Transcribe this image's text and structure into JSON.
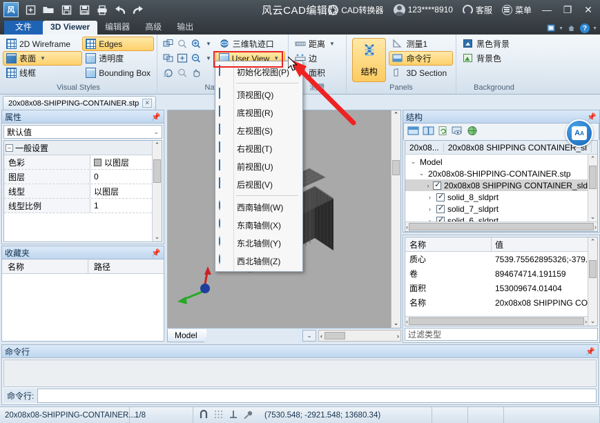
{
  "titlebar": {
    "app_title": "风云CAD编辑器",
    "quick_icons": [
      "new-file-icon",
      "open-folder-icon",
      "save-icon",
      "save-as-icon",
      "print-icon",
      "undo-icon",
      "redo-icon"
    ],
    "converter_label": "CAD转换器",
    "account_label": "123****8910",
    "support_label": "客服",
    "menu_label": "菜单",
    "minimize": "—",
    "maximize": "❐",
    "close": "✕"
  },
  "tabs": {
    "file_label": "文件",
    "items": [
      "3D Viewer",
      "编辑器",
      "高级",
      "输出"
    ],
    "active": "3D Viewer",
    "help_label": "?"
  },
  "ribbon": {
    "groups": [
      {
        "title": "Visual Styles",
        "col1": [
          "2D Wireframe",
          "表面",
          "线框"
        ],
        "col2": [
          "Edges",
          "透明度",
          "Bounding Box"
        ],
        "highlight": [
          "表面",
          "Edges"
        ]
      },
      {
        "title": "Navigation",
        "items": [
          "三维轨迹口",
          "User View"
        ],
        "highlight": [
          "User View"
        ]
      },
      {
        "title": "测量",
        "items": [
          "距离",
          "边",
          "面积"
        ]
      },
      {
        "title": "Panels",
        "big_label": "结构",
        "items": [
          "测量1",
          "命令行",
          "3D Section"
        ],
        "highlight": [
          "命令行"
        ]
      },
      {
        "title": "Background",
        "items": [
          "黑色背景",
          "背景色"
        ]
      }
    ]
  },
  "viewmenu": {
    "items": [
      {
        "label": "初始化视图(P)",
        "icon": "cube-icon"
      },
      {
        "label": "顶视图(Q)",
        "icon": "cube-top-icon"
      },
      {
        "label": "底视图(R)",
        "icon": "cube-bottom-icon"
      },
      {
        "label": "左视图(S)",
        "icon": "cube-left-icon"
      },
      {
        "label": "右视图(T)",
        "icon": "cube-right-icon"
      },
      {
        "label": "前视图(U)",
        "icon": "cube-front-icon"
      },
      {
        "label": "后视图(V)",
        "icon": "cube-back-icon"
      },
      {
        "label": "西南轴侧(W)",
        "icon": "iso-sw-icon"
      },
      {
        "label": "东南轴侧(X)",
        "icon": "iso-se-icon"
      },
      {
        "label": "东北轴侧(Y)",
        "icon": "iso-ne-icon"
      },
      {
        "label": "西北轴侧(Z)",
        "icon": "iso-nw-icon"
      }
    ]
  },
  "leftdock": {
    "doc_tab": "20x08x08-SHIPPING-CONTAINER.stp",
    "properties": {
      "title": "属性",
      "preset": "默认值",
      "group_label": "一般设置",
      "rows": [
        {
          "name": "色彩",
          "value": "以图层",
          "swatch": true
        },
        {
          "name": "图层",
          "value": "0"
        },
        {
          "name": "线型",
          "value": "以图层"
        },
        {
          "name": "线型比例",
          "value": "1"
        }
      ]
    },
    "favorites": {
      "title": "收藏夹",
      "col_name": "名称",
      "col_path": "路径"
    }
  },
  "viewport": {
    "tab_label": "Model"
  },
  "rightdock": {
    "structure": {
      "title": "结构",
      "toolbar_icons": [
        "split-horizontal-icon",
        "split-vertical-icon",
        "refresh-icon",
        "preview-icon",
        "globe-icon"
      ],
      "badge": "translate-icon",
      "crumbs": [
        "20x08...",
        "20x08x08 SHIPPING CONTAINER_sl"
      ],
      "tree": [
        {
          "label": "Model",
          "depth": 0,
          "chevron": "v",
          "checkbox": false
        },
        {
          "label": "20x08x08-SHIPPING-CONTAINER.stp",
          "depth": 1,
          "chevron": "v",
          "checkbox": false
        },
        {
          "label": "20x08x08 SHIPPING CONTAINER_sld",
          "depth": 2,
          "chevron": ">",
          "checkbox": true,
          "selected": true
        },
        {
          "label": "solid_8_sldprt",
          "depth": 2,
          "chevron": ">",
          "checkbox": true
        },
        {
          "label": "solid_7_sldprt",
          "depth": 2,
          "chevron": ">",
          "checkbox": true
        },
        {
          "label": "solid_6_sldprt",
          "depth": 2,
          "chevron": ">",
          "checkbox": true
        }
      ]
    },
    "properties": {
      "col_name": "名称",
      "col_value": "值",
      "rows": [
        {
          "name": "质心",
          "value": "7539.75562895326;-379."
        },
        {
          "name": "卷",
          "value": "894674714.191159"
        },
        {
          "name": "面积",
          "value": "153009674.01404"
        },
        {
          "name": "名称",
          "value": "20x08x08 SHIPPING CO"
        }
      ],
      "filter_placeholder": "过滤类型"
    }
  },
  "command": {
    "panel_title": "命令行",
    "log_text": "",
    "prompt_label": "命令行:",
    "input_value": ""
  },
  "statusbar": {
    "filename": "20x08x08-SHIPPING-CONTAINER....",
    "page": "1/8",
    "snap_icons": [
      "osnap-icon",
      "grid-icon",
      "ortho-icon",
      "polar-icon"
    ],
    "coordinates": "(7530.548; -2921.548; 13680.34)"
  },
  "colors": {
    "accent_highlight": "#fbcb61",
    "highlight_border": "#e2a33c",
    "marker_red": "#ee2222",
    "titlebar_bg": "#3b4248",
    "file_tab_blue": "#1f63b5",
    "viewport_bg": "#a9a9a9",
    "tree_selected": "#d4d4d4"
  }
}
